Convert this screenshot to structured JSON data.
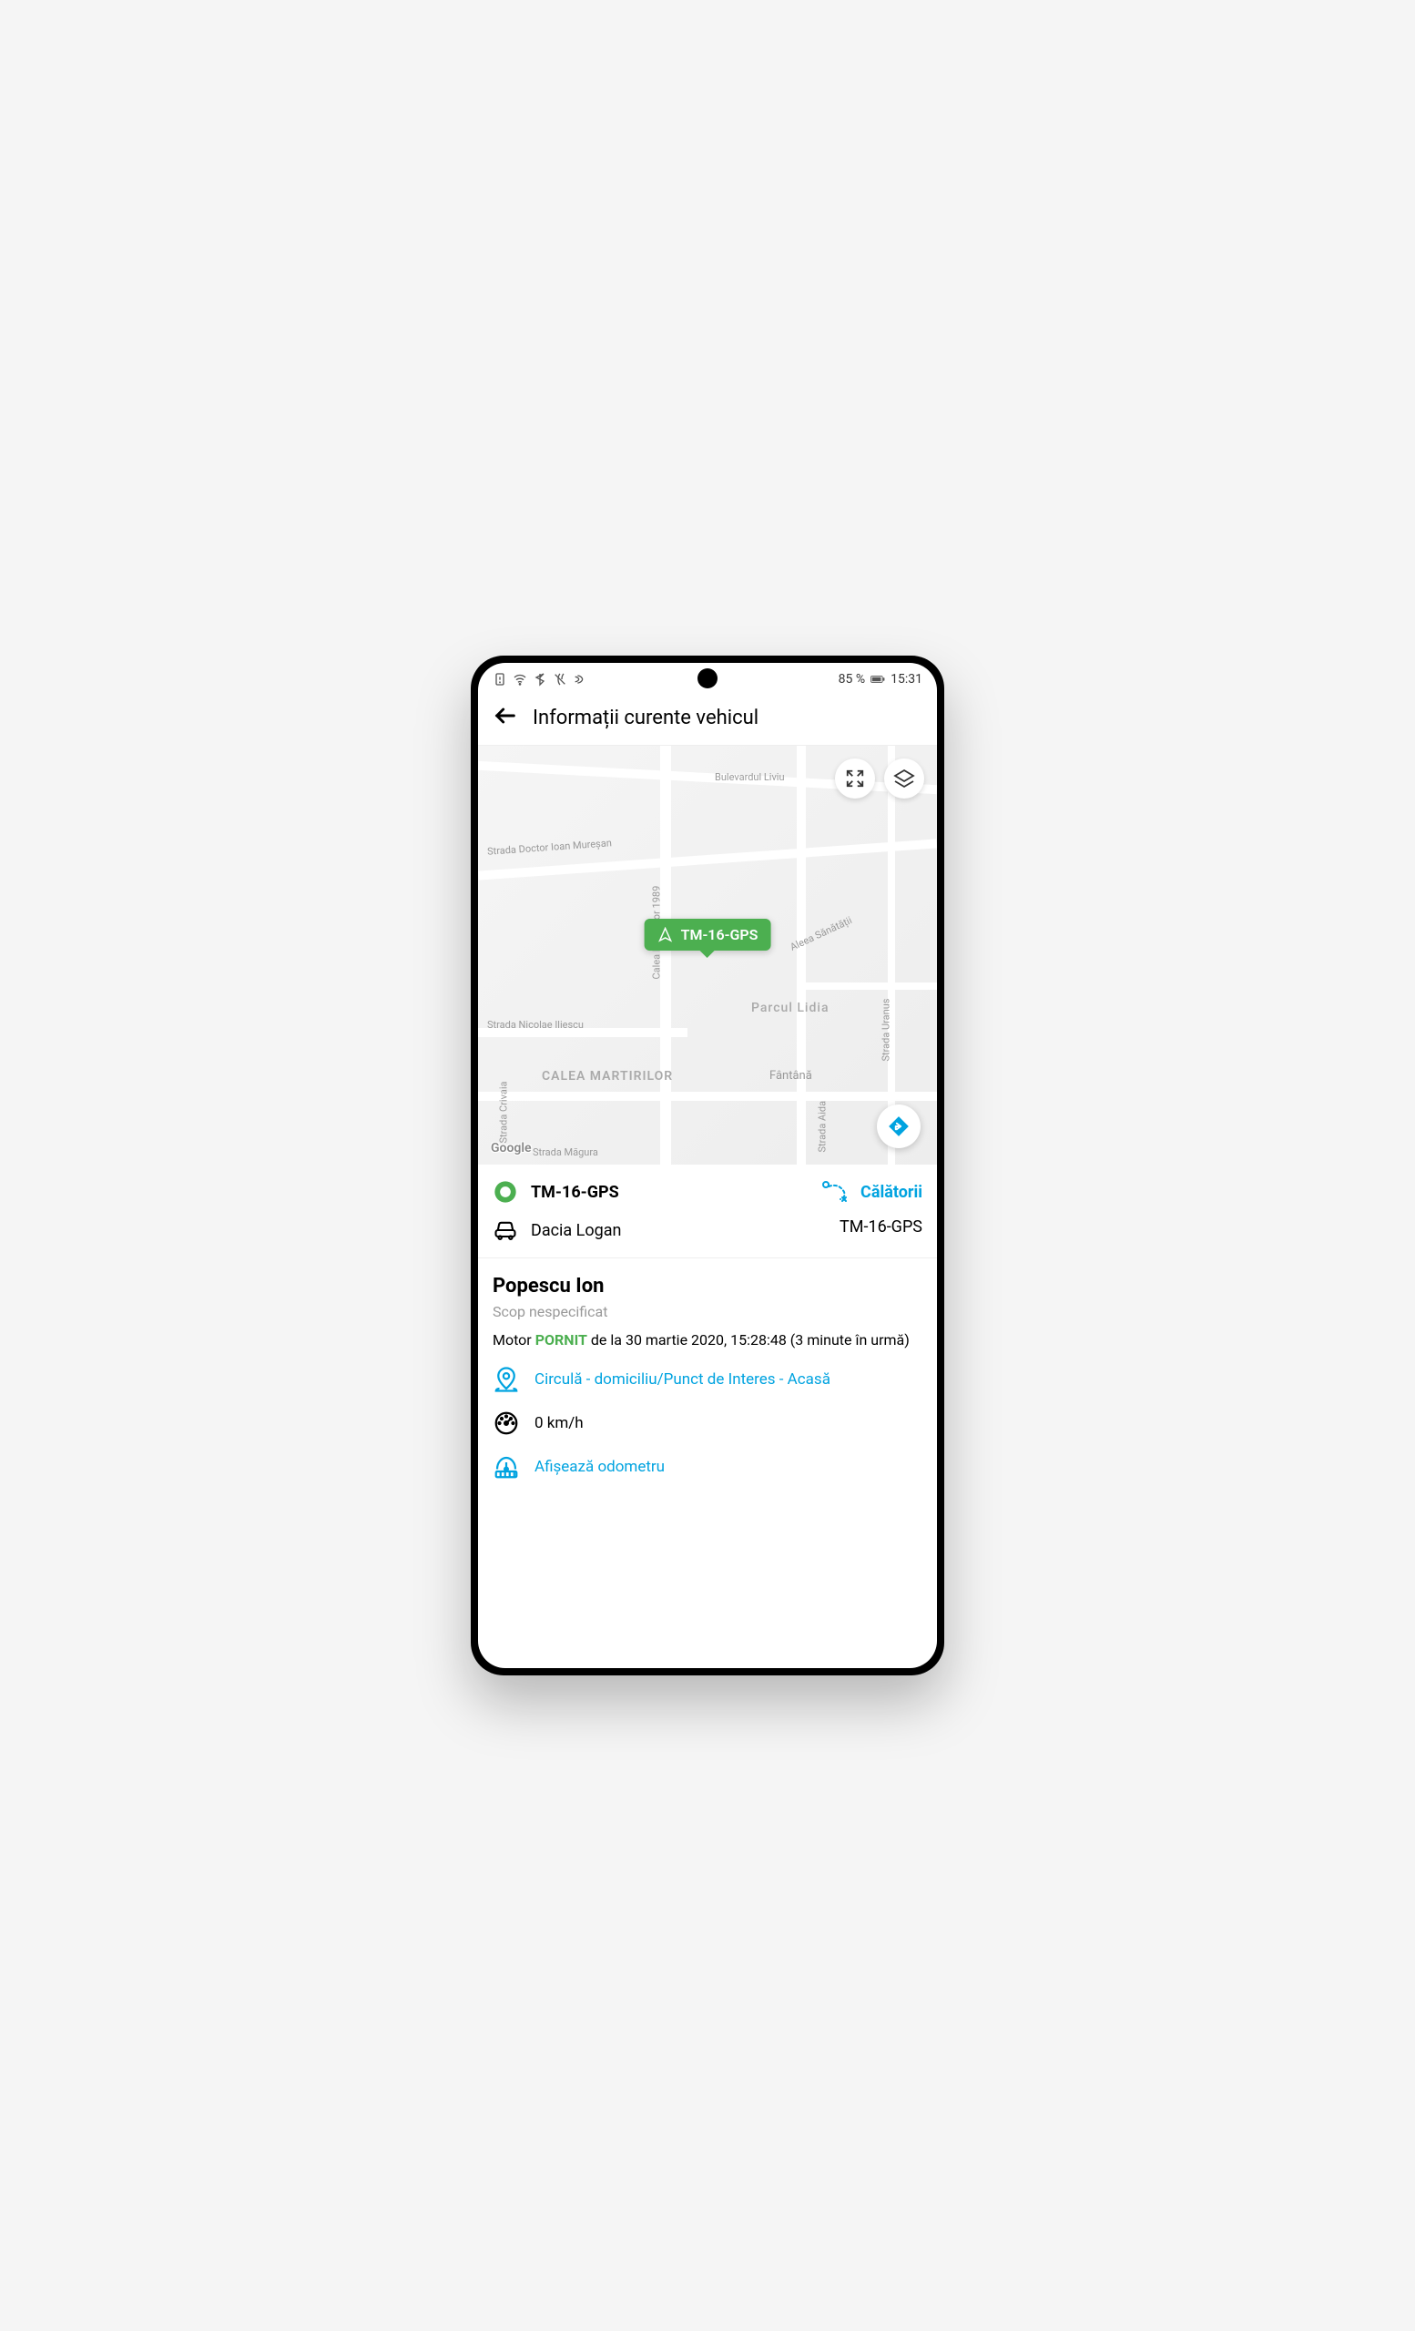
{
  "status_bar": {
    "battery_pct": "85 %",
    "time": "15:31"
  },
  "header": {
    "title": "Informații curente vehicul"
  },
  "map": {
    "vehicle_marker": "TM-16-GPS",
    "google_attrib": "Google",
    "labels": {
      "bulevardul_liviu": "Bulevardul Liviu",
      "strada_muresan": "Strada Doctor Ioan Mureșan",
      "calea_martirilor_1989": "Calea Martirilor 1989",
      "aleea_sanatatii": "Aleea Sănătății",
      "strada_iliesu": "Strada Nicolae Iliescu",
      "parcul_lidia": "Parcul Lidia",
      "strada_uranus": "Strada Uranus",
      "calea_martirilor": "CALEA MARTIRILOR",
      "fantana": "Fântână",
      "strada_aida": "Strada Aida",
      "strada_crivaia": "Strada Crivaia",
      "strada_magura": "Strada Măgura"
    }
  },
  "vehicle": {
    "gps_id": "TM-16-GPS",
    "model": "Dacia Logan",
    "trips_label": "Călătorii",
    "plate": "TM-16-GPS"
  },
  "driver": {
    "name": "Popescu Ion",
    "scope": "Scop nespecificat",
    "motor_prefix": "Motor ",
    "motor_status": "PORNIT",
    "motor_suffix": " de la 30 martie 2020, 15:28:48 (3 minute în urmă)",
    "location_text": "Circulă - domiciliu/Punct de Interes - Acasă",
    "speed": "0 km/h",
    "odometer_label": "Afișează odometru"
  }
}
